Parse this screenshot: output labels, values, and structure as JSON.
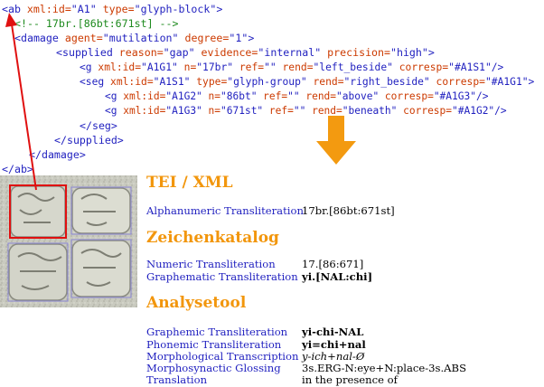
{
  "xml": {
    "l1": {
      "tag": "<ab",
      "a1": " xml:id=",
      "v1": "\"A1\"",
      "a2": " type=",
      "v2": "\"glyph-block\"",
      "end": ">"
    },
    "l2": {
      "comment": "<!-- 17br.[86bt:671st] -->"
    },
    "l3": {
      "tag": "<damage",
      "a1": " agent=",
      "v1": "\"mutilation\"",
      "a2": " degree=",
      "v2": "\"1\"",
      "end": ">"
    },
    "l4": {
      "tag": "<supplied",
      "a1": " reason=",
      "v1": "\"gap\"",
      "a2": " evidence=",
      "v2": "\"internal\"",
      "a3": " precision=",
      "v3": "\"high\"",
      "end": ">"
    },
    "l5": {
      "tag": "<g",
      "a1": " xml:id=",
      "v1": "\"A1G1\"",
      "a2": " n=",
      "v2": "\"17br\"",
      "a3": " ref=",
      "v3": "\"\"",
      "a4": " rend=",
      "v4": "\"left_beside\"",
      "a5": " corresp=",
      "v5": "\"#A1S1\"",
      "end": "/>"
    },
    "l6": {
      "tag": "<seg",
      "a1": " xml:id=",
      "v1": "\"A1S1\"",
      "a2": " type=",
      "v2": "\"glyph-group\"",
      "a3": " rend=",
      "v3": "\"right_beside\"",
      "a4": " corresp=",
      "v4": "\"#A1G1\"",
      "end": ">"
    },
    "l7": {
      "tag": "<g",
      "a1": " xml:id=",
      "v1": "\"A1G2\"",
      "a2": " n=",
      "v2": "\"86bt\"",
      "a3": " ref=",
      "v3": "\"\"",
      "a4": " rend=",
      "v4": "\"above\"",
      "a5": " corresp=",
      "v5": "\"#A1G3\"",
      "end": "/>"
    },
    "l8": {
      "tag": "<g",
      "a1": " xml:id=",
      "v1": "\"A1G3\"",
      "a2": " n=",
      "v2": "\"671st\"",
      "a3": " ref=",
      "v3": "\"\"",
      "a4": " rend=",
      "v4": "\"beneath\"",
      "a5": " corresp=",
      "v5": "\"#A1G2\"",
      "end": "/>"
    },
    "l9": {
      "tag": "</seg>"
    },
    "l10": {
      "tag": "</supplied>"
    },
    "l11": {
      "tag": "</damage>"
    },
    "l12": {
      "tag": "</ab>"
    }
  },
  "sections": {
    "tei": {
      "heading": "TEI / XML",
      "rows": [
        {
          "label": "Alphanumeric Transliteration",
          "value": "17br.[86bt:671st]"
        }
      ]
    },
    "zeichen": {
      "heading": "Zeichenkatalog",
      "rows": [
        {
          "label": "Numeric Transliteration",
          "value": "17.[86:671]"
        },
        {
          "label": "Graphematic Transliteration",
          "value": "yi.[NAL:chi]"
        }
      ]
    },
    "analyse": {
      "heading": "Analysetool",
      "rows": [
        {
          "label": "Graphemic Transliteration",
          "value": "yi-chi-NAL"
        },
        {
          "label": "Phonemic Transliteration",
          "value": "yi=chi+nal"
        },
        {
          "label": "Morphological Transcription",
          "value": "y-ich+nal-Ø"
        },
        {
          "label": "Morphosynactic Glossing",
          "value": "3s.ERG-N:eye+N:place-3s.ABS"
        },
        {
          "label": "Translation",
          "value": "in the presence of"
        }
      ]
    }
  },
  "colors": {
    "tag": "#1f1fbf",
    "attr": "#cc3a00",
    "comment": "#1e8a1e",
    "heading": "#f2960c",
    "red_box": "#e01010",
    "purple_box": "#8a86d6"
  }
}
